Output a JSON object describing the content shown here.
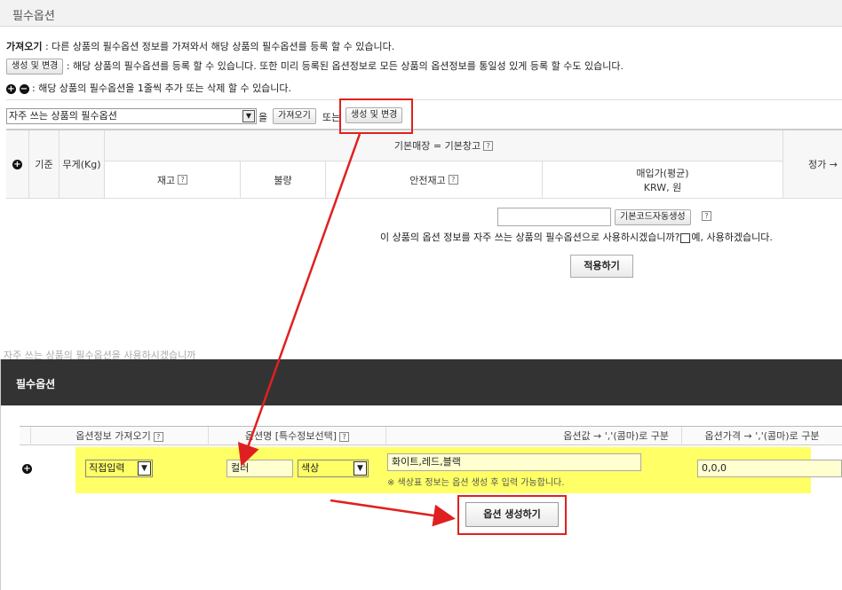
{
  "page": {
    "title": "필수옵션"
  },
  "help": {
    "import_label": "가져오기",
    "import_desc": " : 다른 상품의 필수옵션 정보를 가져와서 해당 상품의 필수옵션를 등록 할 수 있습니다.",
    "create_button": "생성 및 변경",
    "create_desc": " : 해당 상품의 필수옵션를 등록 할 수 있습니다. 또한 미리 등록된 옵션정보로 모든 상품의 옵션정보를 통일성 있게 등록 할 수도 있습니다.",
    "plus_minus_desc": " :  해당 상품의 필수옵션을 1줄씩 추가 또는 삭제 할 수 있습니다."
  },
  "toolbar": {
    "frequent_select": "자주 쓰는 상품의 필수옵션",
    "particle_eul": "을",
    "import_button": "가져오기",
    "or_text": "또는",
    "create_button": "생성 및 변경"
  },
  "table": {
    "col_standard": "기준",
    "col_weight": "무게(Kg)",
    "group_header": "기본매장 = 기본창고",
    "col_stock": "재고",
    "col_defect": "불량",
    "col_safety": "안전재고",
    "col_purchase_line1": "매입가(평균)",
    "col_purchase_line2": "KRW, 원",
    "col_price": "정가 →"
  },
  "code_section": {
    "auto_button": "기본코드자동생성",
    "question": "이 상품의 옵션 정보를 자주 쓰는 상품의 필수옵션으로 사용하시겠습니까?",
    "checkbox_label": "예, 사용하겠습니다."
  },
  "apply_button": "적용하기",
  "faded_text": "자주 쓰는 상품의 필수옵션을 사용하시겠습니까",
  "modal": {
    "title": "필수옵션",
    "headers": {
      "import": "옵션정보 가져오기",
      "name": "옵션명 [특수정보선택]",
      "values": "옵션값 → ','(콤마)로 구분",
      "price": "옵션가격 → ','(콤마)로 구분"
    },
    "row": {
      "input_type": "직접입력",
      "option_name": "컬러",
      "special_select": "색상",
      "option_values": "화이트,레드,블랙",
      "note": "※ 색상표 정보는 옵션 생성 후 입력 가능합니다.",
      "option_price": "0,0,0"
    },
    "generate_button": "옵션 생성하기"
  },
  "colors": {
    "highlight": "#ffff66",
    "annotation_red": "#e02020",
    "modal_header": "#333333"
  }
}
